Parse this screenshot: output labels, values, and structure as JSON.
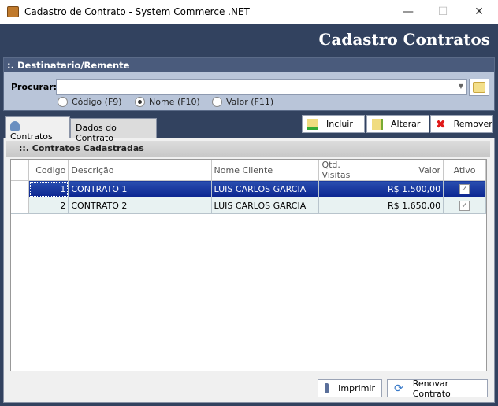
{
  "window": {
    "title": "Cadastro de Contrato - System Commerce .NET",
    "minimize": "—",
    "maximize": "☐",
    "close": "✕"
  },
  "header": {
    "title": "Cadastro Contratos"
  },
  "search_group": {
    "title": ":. Destinatario/Remente",
    "label": "Procurar:",
    "value": "",
    "radios": [
      {
        "label": "Código (F9)",
        "checked": false
      },
      {
        "label": "Nome (F10)",
        "checked": true
      },
      {
        "label": "Valor (F11)",
        "checked": false
      }
    ]
  },
  "tabs": [
    {
      "label": "Contratos",
      "active": true
    },
    {
      "label": "Dados do Contrato",
      "active": false
    }
  ],
  "toolbar": {
    "incluir": "Incluir",
    "alterar": "Alterar",
    "remover": "Remover"
  },
  "grid": {
    "title": "::. Contratos Cadastradas",
    "columns": [
      "Codigo",
      "Descrição",
      "Nome Cliente",
      "Qtd. Visitas",
      "Valor",
      "Ativo"
    ],
    "rows": [
      {
        "codigo": "1",
        "descricao": "CONTRATO 1",
        "cliente": "LUIS CARLOS GARCIA",
        "visitas": "",
        "valor": "R$ 1.500,00",
        "ativo": true,
        "selected": true
      },
      {
        "codigo": "2",
        "descricao": "CONTRATO 2",
        "cliente": "LUIS CARLOS GARCIA",
        "visitas": "",
        "valor": "R$ 1.650,00",
        "ativo": true,
        "selected": false
      }
    ]
  },
  "footer": {
    "imprimir": "Imprimir",
    "renovar": "Renovar Contrato"
  }
}
